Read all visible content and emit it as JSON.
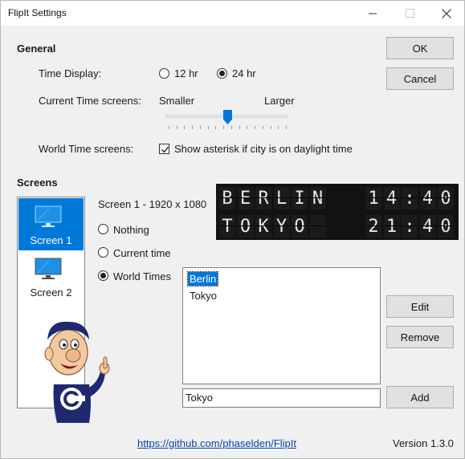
{
  "window": {
    "title": "FlipIt Settings"
  },
  "buttons": {
    "ok": "OK",
    "cancel": "Cancel",
    "edit": "Edit",
    "remove": "Remove",
    "add": "Add"
  },
  "general": {
    "heading": "General",
    "time_display": {
      "label": "Time Display:",
      "options": [
        "12 hr",
        "24 hr"
      ],
      "selected": "24 hr"
    },
    "current_time": {
      "label": "Current Time screens:",
      "min_label": "Smaller",
      "max_label": "Larger",
      "value_fraction": 0.5,
      "tick_count": 16
    },
    "world_time": {
      "label": "World Time screens:",
      "checkbox_label": "Show asterisk if city is on daylight time",
      "checked": true
    }
  },
  "screens": {
    "heading": "Screens",
    "items": [
      {
        "label": "Screen 1",
        "selected": true
      },
      {
        "label": "Screen 2",
        "selected": false
      }
    ],
    "detail": "Screen 1 - 1920 x 1080",
    "modes": [
      "Nothing",
      "Current time",
      "World Times"
    ],
    "selected_mode": "World Times"
  },
  "preview": {
    "rows": [
      {
        "city": "BERLIN",
        "time": "14:40"
      },
      {
        "city": "TOKYO",
        "time": "21:40"
      }
    ]
  },
  "world_times": {
    "cities": [
      "Berlin",
      "Tokyo"
    ],
    "selected_city": "Berlin",
    "input_value": "Tokyo"
  },
  "footer": {
    "link": "https://github.com/phaselden/FlipIt",
    "version": "Version 1.3.0"
  },
  "icons": {
    "monitor": "monitor-icon",
    "checkmark": "checkmark-icon",
    "mascot": "mascot-illustration",
    "minimize": "minimize-icon",
    "maximize": "maximize-icon",
    "close": "close-icon"
  },
  "colors": {
    "accent": "#0078d7",
    "board": "#121212",
    "link": "#0645ad"
  }
}
